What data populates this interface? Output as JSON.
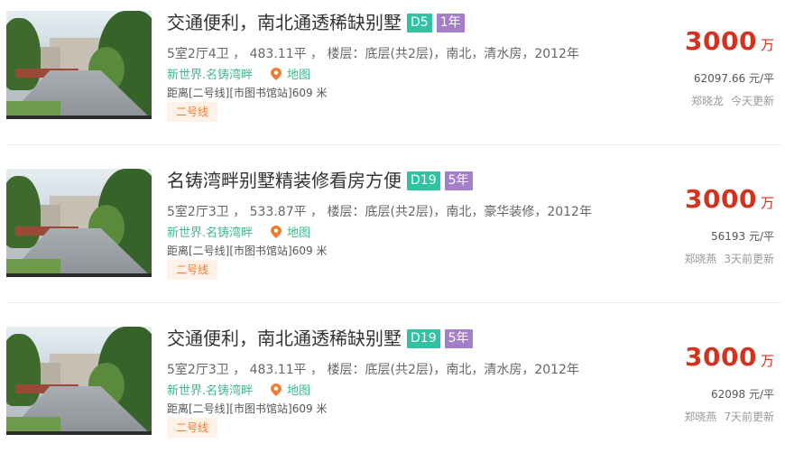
{
  "listings": [
    {
      "title": "交通便利，南北通透稀缺别墅",
      "district_tag": "D5",
      "year_tag": "1年",
      "details": "5室2厅4卫 ， 483.11平 ， 楼层：底层(共2层)，南北，清水房，2012年",
      "community": "新世界.名铸湾畔",
      "map_label": "地图",
      "distance": "距离[二号线][市图书馆站]609 米",
      "metro_tag": "二号线",
      "price": "3000",
      "price_unit": "万",
      "unit_price": "62097.66 元/平",
      "agent": "郑晓龙",
      "updated": "今天更新"
    },
    {
      "title": "名铸湾畔别墅精装修看房方便",
      "district_tag": "D19",
      "year_tag": "5年",
      "details": "5室2厅3卫 ， 533.87平 ， 楼层：底层(共2层)，南北，豪华装修，2012年",
      "community": "新世界.名铸湾畔",
      "map_label": "地图",
      "distance": "距离[二号线][市图书馆站]609 米",
      "metro_tag": "二号线",
      "price": "3000",
      "price_unit": "万",
      "unit_price": "56193 元/平",
      "agent": "郑晓燕",
      "updated": "3天前更新"
    },
    {
      "title": "交通便利，南北通透稀缺别墅",
      "district_tag": "D19",
      "year_tag": "5年",
      "details": "5室2厅3卫 ， 483.11平 ， 楼层：底层(共2层)，南北，清水房，2012年",
      "community": "新世界.名铸湾畔",
      "map_label": "地图",
      "distance": "距离[二号线][市图书馆站]609 米",
      "metro_tag": "二号线",
      "price": "3000",
      "price_unit": "万",
      "unit_price": "62098 元/平",
      "agent": "郑晓燕",
      "updated": "7天前更新"
    }
  ],
  "colors": {
    "price": "#d2321e",
    "community": "#3fb98c",
    "district_tag": "#31c2a2",
    "year_tag": "#a47ec9",
    "metro_tag_bg": "#fff1e6",
    "metro_tag_text": "#f07d33"
  },
  "icons": {
    "map": "map-pin-icon"
  }
}
